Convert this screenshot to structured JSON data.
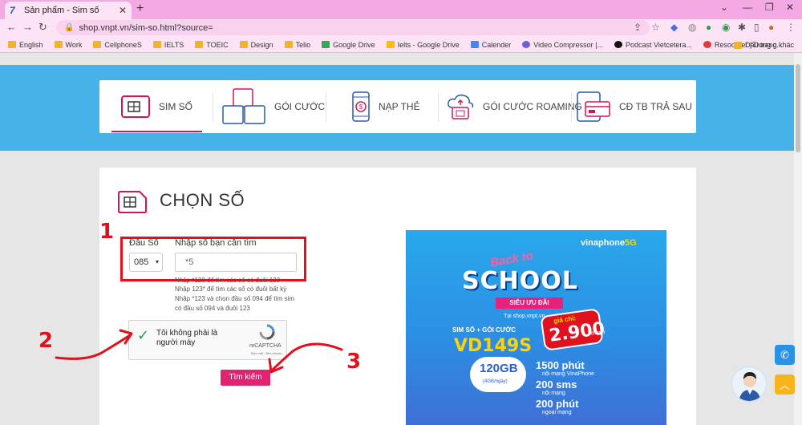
{
  "browser": {
    "tab_title": "Sản phẩm - Sim số",
    "url": "shop.vnpt.vn/sim-so.html?source=",
    "bookmarks": [
      "English",
      "Work",
      "CellphoneS",
      "IELTS",
      "TOEIC",
      "Design",
      "Telio",
      "Google Drive",
      "Ielts - Google Drive",
      "Calender",
      "Video Compressor |...",
      "Podcast Vietcetera...",
      "Resoomer | Dung c..."
    ],
    "bookmarks_right": "Dấu trang khác"
  },
  "menu": {
    "items": [
      {
        "label": "SIM SỐ",
        "icon": "sim-card-icon",
        "active": true
      },
      {
        "label": "GÓI CƯỚC",
        "icon": "package-boxes-icon"
      },
      {
        "label": "NẠP THẺ",
        "icon": "phone-topup-icon"
      },
      {
        "label": "GÓI CƯỚC ROAMING",
        "icon": "roaming-cloud-icon"
      },
      {
        "label": "CĐ TB TRẢ SAU",
        "icon": "credit-card-icon"
      }
    ]
  },
  "form": {
    "title": "CHỌN SỐ",
    "prefix_label": "Đầu Số",
    "prefix_value": "085",
    "number_label": "Nhập số bạn cần tìm",
    "number_value": "*5",
    "hints": [
      "Nhập *123 để tìm các số có đuôi 123",
      "Nhập 123* để tìm các số có đuôi bất kỳ",
      "Nhập *123 và chọn đầu số 094 để tìm sim",
      "có đầu số 094 và đuôi 123"
    ],
    "captcha_text": "Tôi không phải là người máy",
    "captcha_brand": "reCAPTCHA",
    "captcha_terms": "Bảo mật - Điều khoản",
    "search_button": "Tìm kiếm"
  },
  "annotations": [
    "1",
    "2",
    "3"
  ],
  "banner": {
    "brand": "vinaphone",
    "brand_badge": "5G",
    "back_to": "Back to",
    "school": "SCHOOL",
    "ribbon": "SIÊU ƯU ĐÃI",
    "site": "Tại shop.vnpt.vn",
    "plan_line": "SIM SỐ + GÓI CƯỚC",
    "plan_code": "VD149S",
    "price_label": "giá chỉ:",
    "price": "2.900",
    "price_unit": "đ/ngày",
    "data": "120GB",
    "data_sub": "(4GB/ngày)",
    "stats": [
      {
        "value": "1500 phút",
        "sub": "nội mạng VinaPhone"
      },
      {
        "value": "200 sms",
        "sub": "nội mạng"
      },
      {
        "value": "200 phút",
        "sub": "ngoại mạng"
      }
    ]
  },
  "colors": {
    "accent": "#d4145a",
    "band": "#46b2e8",
    "annotation": "#e0101e"
  }
}
